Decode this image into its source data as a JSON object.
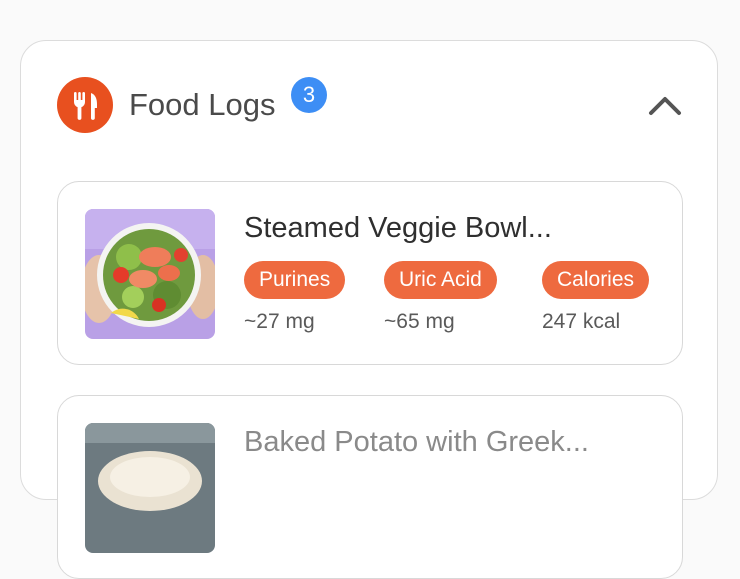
{
  "section": {
    "title": "Food Logs",
    "count": "3",
    "header_icon": "fork-knife-icon",
    "collapse_icon": "chevron-up-icon",
    "accent_color": "#e8501f",
    "badge_color": "#3d8ef5"
  },
  "logs": [
    {
      "title": "Steamed Veggie Bowl...",
      "image": "salmon-salad-bowl",
      "metrics": [
        {
          "label": "Purines",
          "value": "~27 mg"
        },
        {
          "label": "Uric Acid",
          "value": "~65 mg"
        },
        {
          "label": "Calories",
          "value": "247 kcal"
        }
      ]
    },
    {
      "title": "Baked Potato with Greek...",
      "image": "baked-potato-bowl"
    }
  ],
  "pill_color": "#ee6a3f"
}
